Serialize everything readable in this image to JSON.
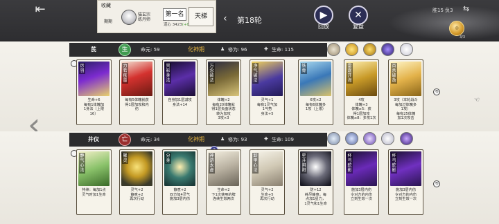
{
  "header": {
    "back_icon": "back-arrow-icon",
    "favorite_label": "收藏",
    "period_label": "期期",
    "player_name": "猫玄宗\n练丹师",
    "rank": "第一名",
    "score_prefix": "道心",
    "score_value": "3423",
    "score_delta": "(+0)",
    "ladder_label": "天梯",
    "round_label": "第18轮",
    "replay_label": "回放",
    "review_label": "复盘",
    "win_loss": "胜15 负3",
    "coin_count": "3/3"
  },
  "players": [
    {
      "name": "芪",
      "realm_icon": "生",
      "life_label": "命元:",
      "life_value": "59",
      "realm_label": "化神期",
      "cultivation_label": "修为:",
      "cultivation_value": "96",
      "hp_label": "生命:",
      "hp_value": "115",
      "cards": [
        {
          "name": "厉羽",
          "desc": "生命+6\n每有1体魄加\n1身法（上限\n16）"
        },
        {
          "name": "力若疾雷",
          "desc": "每有5体魄就获\n得1层加攻和内\n伤"
        },
        {
          "name": "冥影身法",
          "desc": "自身加1层减攻\n身法+14"
        },
        {
          "name": "万念破法",
          "desc": "体魄+2\n每有20体魄就\n得1层负面状态\n转为加攻\n3攻×3"
        },
        {
          "name": "净气破法",
          "desc": "灵气+1\n每有1灵气加\n1气势\n身法+5"
        },
        {
          "name": "铁骨",
          "desc": "6攻×2\n每有6体魄多\n1攻（上限）"
        },
        {
          "name": "雷霆开海",
          "desc": "4攻\n体魄+3\n体魄≥5：获\n得1层加攻\n体魄≥8：多攻1次"
        },
        {
          "name": "百杀破劫",
          "desc": "3攻（本轮战斗\n每加过体魄多\n1攻）\n每有25体魄\n加1次攻击"
        }
      ]
    },
    {
      "name": "井仪",
      "realm_icon": "亡",
      "life_label": "命元:",
      "life_value": "34",
      "realm_label": "化神期",
      "cultivation_label": "修为:",
      "cultivation_value": "93",
      "hp_label": "生命:",
      "hp_value": "109",
      "cards": [
        {
          "name": "静气心法",
          "desc": "持续：每加1点\n灵气时加1生命"
        },
        {
          "name": "聚灵",
          "desc": "灵气+2\n静意+2\n再次行动"
        },
        {
          "name": "分身",
          "desc": "静意+2\n双方加4灵气\n施加3层内伤"
        },
        {
          "name": "神游太虚",
          "desc": "生命+2\n下1次使用的牌\n连续生效两次"
        },
        {
          "name": "卸甲心法",
          "desc": "灵气+2\n生命+5\n再次行动"
        },
        {
          "name": "星斗阴阳",
          "desc": "防+12\n耗尽静意，每\n点加1星力，\n1灵气和1生命"
        },
        {
          "name": "杯弓蛇影",
          "desc": "施加3层内伤\n令对方的内伤\n立刻生效一次"
        },
        {
          "name": "杯弓蛇影",
          "desc": "施加3层内伤\n令对方的内伤\n立刻生效一次"
        }
      ]
    }
  ],
  "level_badge_text": "3",
  "icons": [
    "back-arrow-icon",
    "play-icon",
    "close-icon",
    "share-icon",
    "chevron-left-icon",
    "gold-coin-icon"
  ]
}
